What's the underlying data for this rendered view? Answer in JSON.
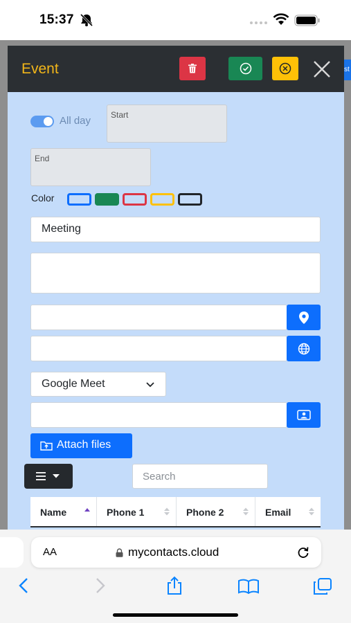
{
  "status": {
    "time": "15:37"
  },
  "modal": {
    "title": "Event",
    "all_day_label": "All day",
    "all_day_on": true,
    "start_label": "Start",
    "end_label": "End",
    "color_label": "Color",
    "swatches": [
      "#0d6efd",
      "#198754",
      "#dc3545",
      "#ffc107",
      "#212529"
    ],
    "title_value": "Meeting",
    "meeting_select": "Google Meet",
    "attach_label": "Attach files",
    "search_placeholder": "Search",
    "table_headers": [
      "Name",
      "Phone 1",
      "Phone 2",
      "Email"
    ]
  },
  "browser": {
    "aa_label": "AA",
    "url": "mycontacts.cloud"
  },
  "colors": {
    "header_bg": "#2b2f33",
    "title": "#f2b619",
    "modal_bg": "#c4dcfa",
    "primary": "#0d6efd",
    "danger": "#dc3545",
    "success": "#198754",
    "warning": "#ffc107"
  },
  "icons": [
    "bell-slash-icon",
    "wifi-icon",
    "battery-icon",
    "trash-icon",
    "check-circle-icon",
    "x-circle-icon",
    "close-icon",
    "map-marker-icon",
    "globe-icon",
    "chevron-down-icon",
    "video-conference-icon",
    "folder-upload-icon",
    "menu-icon",
    "sort-icon",
    "lock-icon",
    "reload-icon",
    "back-icon",
    "forward-icon",
    "share-icon",
    "bookmarks-icon",
    "tabs-icon"
  ]
}
